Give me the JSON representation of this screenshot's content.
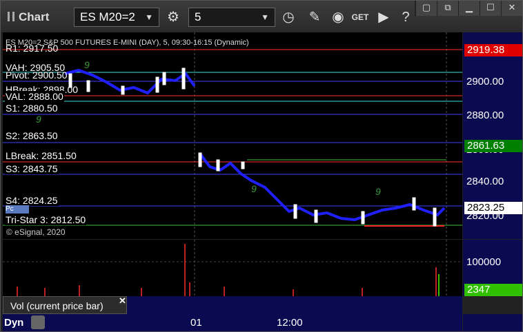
{
  "toolbar": {
    "title": "Chart",
    "symbol": "ES M20=2",
    "interval": "5",
    "buttons": [
      "gear-icon",
      "clock-icon",
      "pencil-icon",
      "indicator-icon",
      "get-icon",
      "play-icon",
      "help-icon"
    ]
  },
  "window_controls": [
    "restore",
    "resize",
    "minimize",
    "maximize",
    "close"
  ],
  "chart": {
    "symbol_line": "ES M20=2 S&P 500 FUTURES E-MINI (DAY), 5, 09:30-16:15 (Dynamic)",
    "copyright": "© eSignal, 2020",
    "levels": [
      {
        "label": "R1: 2917.50",
        "color": "#ff3030"
      },
      {
        "label": "VAH: 2905.50",
        "color": "#40e0e0"
      },
      {
        "label": "Pivot: 2900.50",
        "color": "#4040ff"
      },
      {
        "label": "HBreak: 2898.00",
        "color": "#ff3030"
      },
      {
        "label": "VAL: 2888.00",
        "color": "#40e0e0"
      },
      {
        "label": "S1: 2880.50",
        "color": "#4040ff"
      },
      {
        "label": "S2: 2863.50",
        "color": "#4040ff"
      },
      {
        "label": "LBreak: 2851.50",
        "color": "#ff3030"
      },
      {
        "label": "S3: 2843.75",
        "color": "#4040ff"
      },
      {
        "label": "S4: 2824.25",
        "color": "#4040ff"
      },
      {
        "label": "Tri-Star 3: 2812.50",
        "color": "#40c040"
      }
    ],
    "price_ticks": [
      "2900.00",
      "2880.00",
      "2860.00",
      "2840.00",
      "2820.00"
    ],
    "price_tags": [
      {
        "value": "2919.38",
        "bg": "#e00000"
      },
      {
        "value": "2861.63",
        "bg": "#008000"
      },
      {
        "value": "2823.25",
        "bg": "#ffffff"
      }
    ],
    "pc_label": "Pc"
  },
  "volume": {
    "label": "Vol (current price bar)",
    "tick": "100000",
    "tag": "2347",
    "tag_bg": "#30c000"
  },
  "xaxis": {
    "labels": [
      "01",
      "12:00"
    ]
  },
  "status": {
    "mode": "Dyn"
  }
}
